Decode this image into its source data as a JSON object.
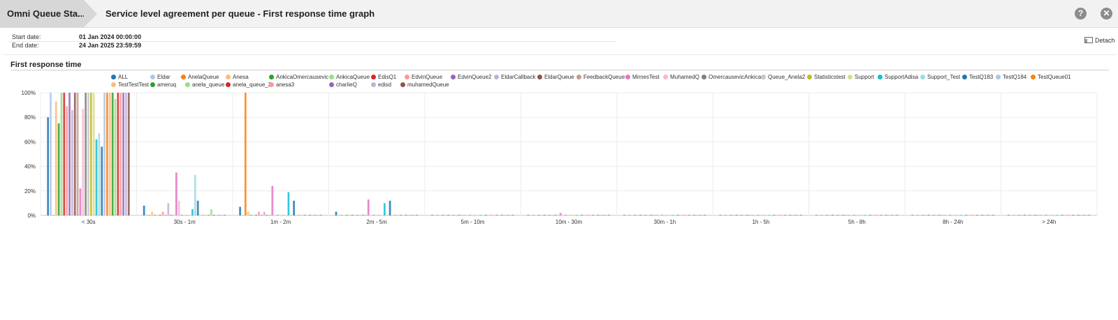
{
  "header": {
    "breadcrumb": "Omni Queue Sta...",
    "title": "Service level agreement per queue - First response time graph",
    "help_icon": "help-icon",
    "close_icon": "close-icon"
  },
  "dates": {
    "start_label": "Start date:",
    "start_value": "01 Jan 2024 00:00:00",
    "end_label": "End date:",
    "end_value": "24 Jan 2025 23:59:59"
  },
  "detach": {
    "label": "Detach",
    "icon": "detach-icon"
  },
  "chart_title": "First response time",
  "colors": {
    "grid": "#ececec",
    "axis": "#c8c8c8",
    "header_bg": "#f2f2f2",
    "breadcrumb_bg": "#d7d7d7"
  },
  "chart_data": {
    "type": "bar",
    "title": "First response time",
    "xlabel": "",
    "ylabel": "",
    "ylim": [
      0,
      100
    ],
    "yticks": [
      "0%",
      "20%",
      "40%",
      "60%",
      "80%",
      "100%"
    ],
    "grid": true,
    "legend_position": "top",
    "categories": [
      "< 30s",
      "30s - 1m",
      "1m - 2m",
      "2m - 5m",
      "5m - 10m",
      "10m - 30m",
      "30m - 1h",
      "1h - 5h",
      "5h - 8h",
      "8h - 24h",
      "> 24h"
    ],
    "series": [
      {
        "name": "ALL",
        "color": "#1f77b4",
        "values": [
          80,
          8,
          7,
          3,
          0,
          0,
          0,
          0,
          0,
          0,
          0
        ]
      },
      {
        "name": "Eldar",
        "color": "#aec7e8",
        "values": [
          100,
          0,
          0,
          0,
          0,
          0,
          0,
          0,
          0,
          0,
          0
        ]
      },
      {
        "name": "AnelaQueue",
        "color": "#ff7f0e",
        "values": [
          0,
          0,
          100,
          0,
          0,
          0,
          0,
          0,
          0,
          0,
          0
        ]
      },
      {
        "name": "Anesa",
        "color": "#ffbb78",
        "values": [
          93,
          3,
          3,
          0,
          0,
          0,
          0,
          0,
          0,
          0,
          0
        ]
      },
      {
        "name": "AnkicaOmercausevic",
        "color": "#2ca02c",
        "values": [
          75,
          0,
          0,
          0,
          0,
          0,
          0,
          0,
          0,
          0,
          0
        ]
      },
      {
        "name": "AnkicaQueue",
        "color": "#98df8a",
        "values": [
          100,
          0,
          0,
          0,
          0,
          0,
          0,
          0,
          0,
          0,
          0
        ]
      },
      {
        "name": "EdisQ1",
        "color": "#d62728",
        "values": [
          100,
          0,
          0,
          0,
          0,
          0,
          0,
          0,
          0,
          0,
          0
        ]
      },
      {
        "name": "EdvinQueue",
        "color": "#ff9896",
        "values": [
          89,
          3,
          3,
          0,
          0,
          0,
          0,
          0,
          0,
          0,
          0
        ]
      },
      {
        "name": "EdvinQueue2",
        "color": "#9467bd",
        "values": [
          100,
          0,
          0,
          0,
          0,
          0,
          0,
          0,
          0,
          0,
          0
        ]
      },
      {
        "name": "EldarCallback",
        "color": "#c5b0d5",
        "values": [
          86,
          10,
          3,
          0,
          0,
          0,
          0,
          0,
          0,
          0,
          0
        ]
      },
      {
        "name": "EldarQueue",
        "color": "#8c564b",
        "values": [
          100,
          0,
          0,
          0,
          0,
          0,
          0,
          0,
          0,
          0,
          0
        ]
      },
      {
        "name": "FeedbackQueue",
        "color": "#c49c94",
        "values": [
          100,
          0,
          0,
          0,
          0,
          0,
          0,
          0,
          0,
          0,
          0
        ]
      },
      {
        "name": "MirnesTest",
        "color": "#e377c2",
        "values": [
          22,
          35,
          24,
          13,
          0,
          2,
          0,
          0,
          0,
          0,
          0
        ]
      },
      {
        "name": "MuhamedQ",
        "color": "#f7b6d2",
        "values": [
          87,
          12,
          0,
          0,
          0,
          0,
          0,
          0,
          0,
          0,
          0
        ]
      },
      {
        "name": "OmercausevicAnkica",
        "color": "#7f7f7f",
        "values": [
          100,
          0,
          0,
          0,
          0,
          0,
          0,
          0,
          0,
          0,
          0
        ]
      },
      {
        "name": "Queue_Anela2",
        "color": "#c7c7c7",
        "values": [
          100,
          0,
          0,
          0,
          0,
          0,
          0,
          0,
          0,
          0,
          0
        ]
      },
      {
        "name": "Statisticstest",
        "color": "#bcbd22",
        "values": [
          100,
          0,
          0,
          0,
          0,
          0,
          0,
          0,
          0,
          0,
          0
        ]
      },
      {
        "name": "Support",
        "color": "#dbdb8d",
        "values": [
          100,
          0,
          0,
          0,
          0,
          0,
          0,
          0,
          0,
          0,
          0
        ]
      },
      {
        "name": "SupportAdisa",
        "color": "#17becf",
        "values": [
          62,
          5,
          19,
          10,
          0,
          0,
          0,
          0,
          0,
          0,
          0
        ]
      },
      {
        "name": "Support_Test",
        "color": "#9edae5",
        "values": [
          67,
          33,
          0,
          0,
          0,
          0,
          0,
          0,
          0,
          0,
          0
        ]
      },
      {
        "name": "TestQ183",
        "color": "#1f77b4",
        "values": [
          56,
          12,
          12,
          12,
          0,
          0,
          0,
          0,
          0,
          0,
          0
        ]
      },
      {
        "name": "TestQ184",
        "color": "#aec7e8",
        "values": [
          100,
          0,
          0,
          0,
          0,
          0,
          0,
          0,
          0,
          0,
          0
        ]
      },
      {
        "name": "TestQueue01",
        "color": "#ff7f0e",
        "values": [
          100,
          0,
          0,
          0,
          0,
          0,
          0,
          0,
          0,
          0,
          0
        ]
      },
      {
        "name": "TestTestTest",
        "color": "#ffbb78",
        "values": [
          100,
          0,
          0,
          0,
          0,
          0,
          0,
          0,
          0,
          0,
          0
        ]
      },
      {
        "name": "ameruq",
        "color": "#2ca02c",
        "values": [
          100,
          0,
          0,
          0,
          0,
          0,
          0,
          0,
          0,
          0,
          0
        ]
      },
      {
        "name": "anela_queue",
        "color": "#98df8a",
        "values": [
          95,
          5,
          0,
          0,
          0,
          0,
          0,
          0,
          0,
          0,
          0
        ]
      },
      {
        "name": "anela_queue_2",
        "color": "#d62728",
        "values": [
          100,
          0,
          0,
          0,
          0,
          0,
          0,
          0,
          0,
          0,
          0
        ]
      },
      {
        "name": "anesa3",
        "color": "#ff9896",
        "values": [
          100,
          0,
          0,
          0,
          0,
          0,
          0,
          0,
          0,
          0,
          0
        ]
      },
      {
        "name": "charlieQ",
        "color": "#9467bd",
        "values": [
          100,
          0,
          0,
          0,
          0,
          0,
          0,
          0,
          0,
          0,
          0
        ]
      },
      {
        "name": "edisd",
        "color": "#c5b0d5",
        "values": [
          100,
          0,
          0,
          0,
          0,
          0,
          0,
          0,
          0,
          0,
          0
        ]
      },
      {
        "name": "muhamedQueue",
        "color": "#8c564b",
        "values": [
          100,
          0,
          0,
          0,
          0,
          0,
          0,
          0,
          0,
          0,
          0
        ]
      }
    ]
  }
}
